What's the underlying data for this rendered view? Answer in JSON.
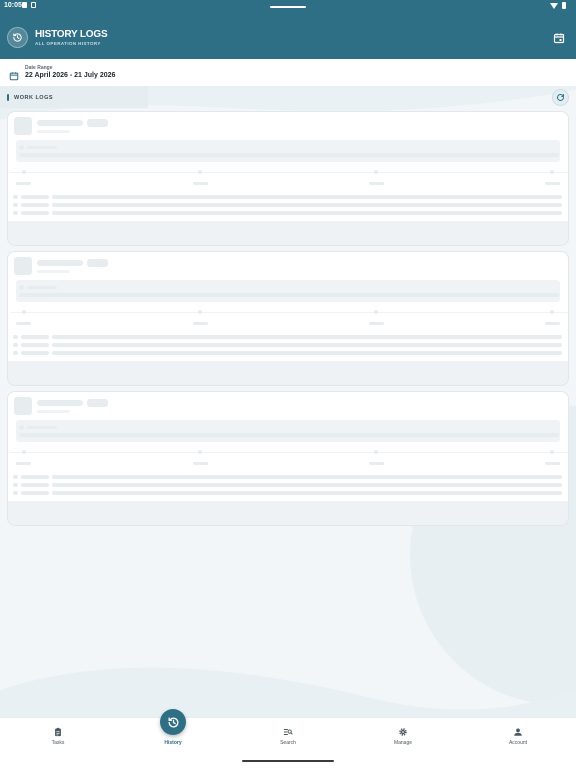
{
  "status_bar": {
    "time": "10:05"
  },
  "header": {
    "title": "HISTORY LOGS",
    "subtitle": "ALL OPERATION HISTORY"
  },
  "date_range": {
    "label": "Date Range",
    "value": "22 April 2026 - 21 July 2026"
  },
  "section": {
    "title": "WORK LOGS"
  },
  "bottom_nav": {
    "items": [
      {
        "label": "Tasks",
        "icon": "clipboard-icon"
      },
      {
        "label": "History",
        "icon": "history-icon",
        "active": true
      },
      {
        "label": "Search",
        "icon": "search-list-icon"
      },
      {
        "label": "Manage",
        "icon": "gear-icon"
      },
      {
        "label": "Account",
        "icon": "person-icon"
      }
    ]
  },
  "colors": {
    "primary": "#2e6f86",
    "background": "#f2f6f8",
    "skeleton": "#e7ecef"
  }
}
